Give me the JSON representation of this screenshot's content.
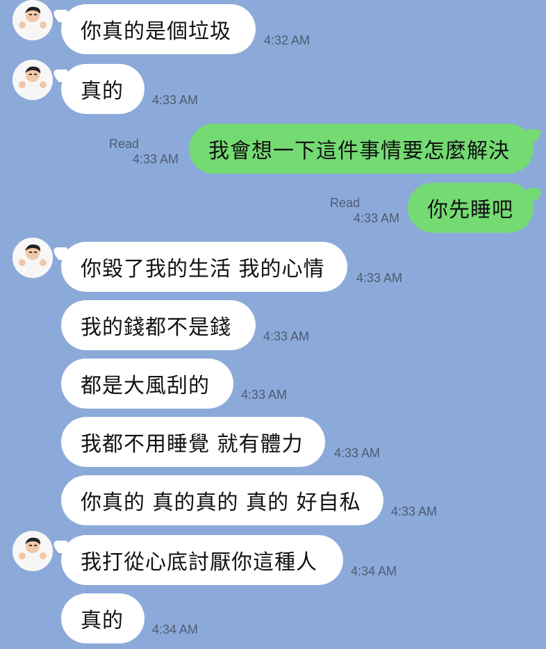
{
  "chat": {
    "messages": [
      {
        "text": "你真的是個垃圾",
        "time": "4:32 AM"
      },
      {
        "text": "真的",
        "time": "4:33 AM"
      },
      {
        "text": "我會想一下這件事情要怎麼解決",
        "read": "Read",
        "time": "4:33 AM"
      },
      {
        "text": "你先睡吧",
        "read": "Read",
        "time": "4:33 AM"
      },
      {
        "text": "你毀了我的生活 我的心情",
        "time": "4:33 AM"
      },
      {
        "text": "我的錢都不是錢",
        "time": "4:33 AM"
      },
      {
        "text": "都是大風刮的",
        "time": "4:33 AM"
      },
      {
        "text": "我都不用睡覺 就有體力",
        "time": "4:33 AM"
      },
      {
        "text": "你真的 真的真的 真的 好自私",
        "time": "4:33 AM"
      },
      {
        "text": "我打從心底討厭你這種人",
        "time": "4:34 AM"
      },
      {
        "text": "真的",
        "time": "4:34 AM"
      }
    ]
  }
}
